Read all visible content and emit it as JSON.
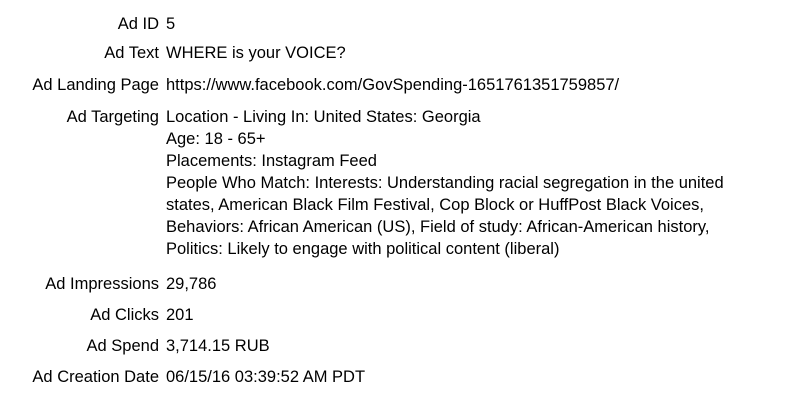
{
  "fields": {
    "ad_id": {
      "label": "Ad ID",
      "value": "5"
    },
    "ad_text": {
      "label": "Ad Text",
      "value": "WHERE is your VOICE?"
    },
    "ad_landing_page": {
      "label": "Ad Landing Page",
      "value": "https://www.facebook.com/GovSpending-1651761351759857/"
    },
    "ad_targeting": {
      "label": "Ad Targeting",
      "lines": [
        "Location - Living In: United States: Georgia",
        "Age: 18 - 65+",
        "Placements: Instagram Feed",
        "People Who Match: Interests: Understanding racial segregation in the united",
        "states, American Black Film Festival, Cop Block or HuffPost Black Voices,",
        "Behaviors: African American (US), Field of study: African-American history,",
        "Politics: Likely to engage with political content (liberal)"
      ]
    },
    "ad_impressions": {
      "label": "Ad Impressions",
      "value": "29,786"
    },
    "ad_clicks": {
      "label": "Ad Clicks",
      "value": "201"
    },
    "ad_spend": {
      "label": "Ad Spend",
      "value": "3,714.15 RUB"
    },
    "ad_creation_date": {
      "label": "Ad Creation Date",
      "value": "06/15/16 03:39:52 AM PDT"
    }
  }
}
